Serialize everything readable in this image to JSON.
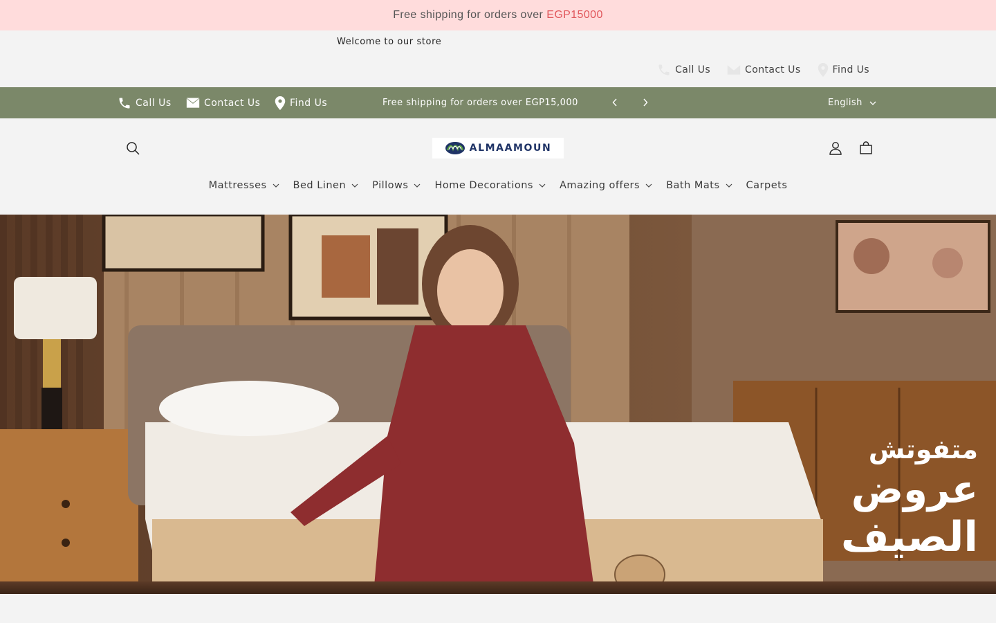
{
  "promo": {
    "text": "Free shipping for orders over",
    "amount": "EGP15000"
  },
  "welcome": "Welcome to our store",
  "top_links": [
    {
      "label": "Call Us",
      "icon": "phone-icon"
    },
    {
      "label": "Contact Us",
      "icon": "envelope-icon"
    },
    {
      "label": "Find Us",
      "icon": "map-pin-icon"
    }
  ],
  "green_bar": {
    "links": [
      {
        "label": "Call Us",
        "icon": "phone-icon"
      },
      {
        "label": "Contact Us",
        "icon": "envelope-icon"
      },
      {
        "label": "Find Us",
        "icon": "map-pin-icon"
      }
    ],
    "announcement": "Free shipping for orders over EGP15,000",
    "language": "English",
    "background": "#7b8869"
  },
  "header": {
    "logo_text": "ALMAAMOUN",
    "icons": [
      "search-icon",
      "account-icon",
      "cart-icon"
    ]
  },
  "nav": [
    {
      "label": "Mattresses",
      "has_dropdown": true
    },
    {
      "label": "Bed Linen",
      "has_dropdown": true
    },
    {
      "label": "Pillows",
      "has_dropdown": true
    },
    {
      "label": "Home Decorations",
      "has_dropdown": true
    },
    {
      "label": "Amazing offers",
      "has_dropdown": true
    },
    {
      "label": "Bath Mats",
      "has_dropdown": true
    },
    {
      "label": "Carpets",
      "has_dropdown": false
    }
  ],
  "hero": {
    "headline": [
      "متفوتش",
      "عروض",
      "الصيف"
    ]
  },
  "colors": {
    "promo_bg": "#ffdcdc",
    "promo_accent": "#e0565b",
    "page_bg": "#f3f3f3",
    "brand_navy": "#1f3366"
  }
}
